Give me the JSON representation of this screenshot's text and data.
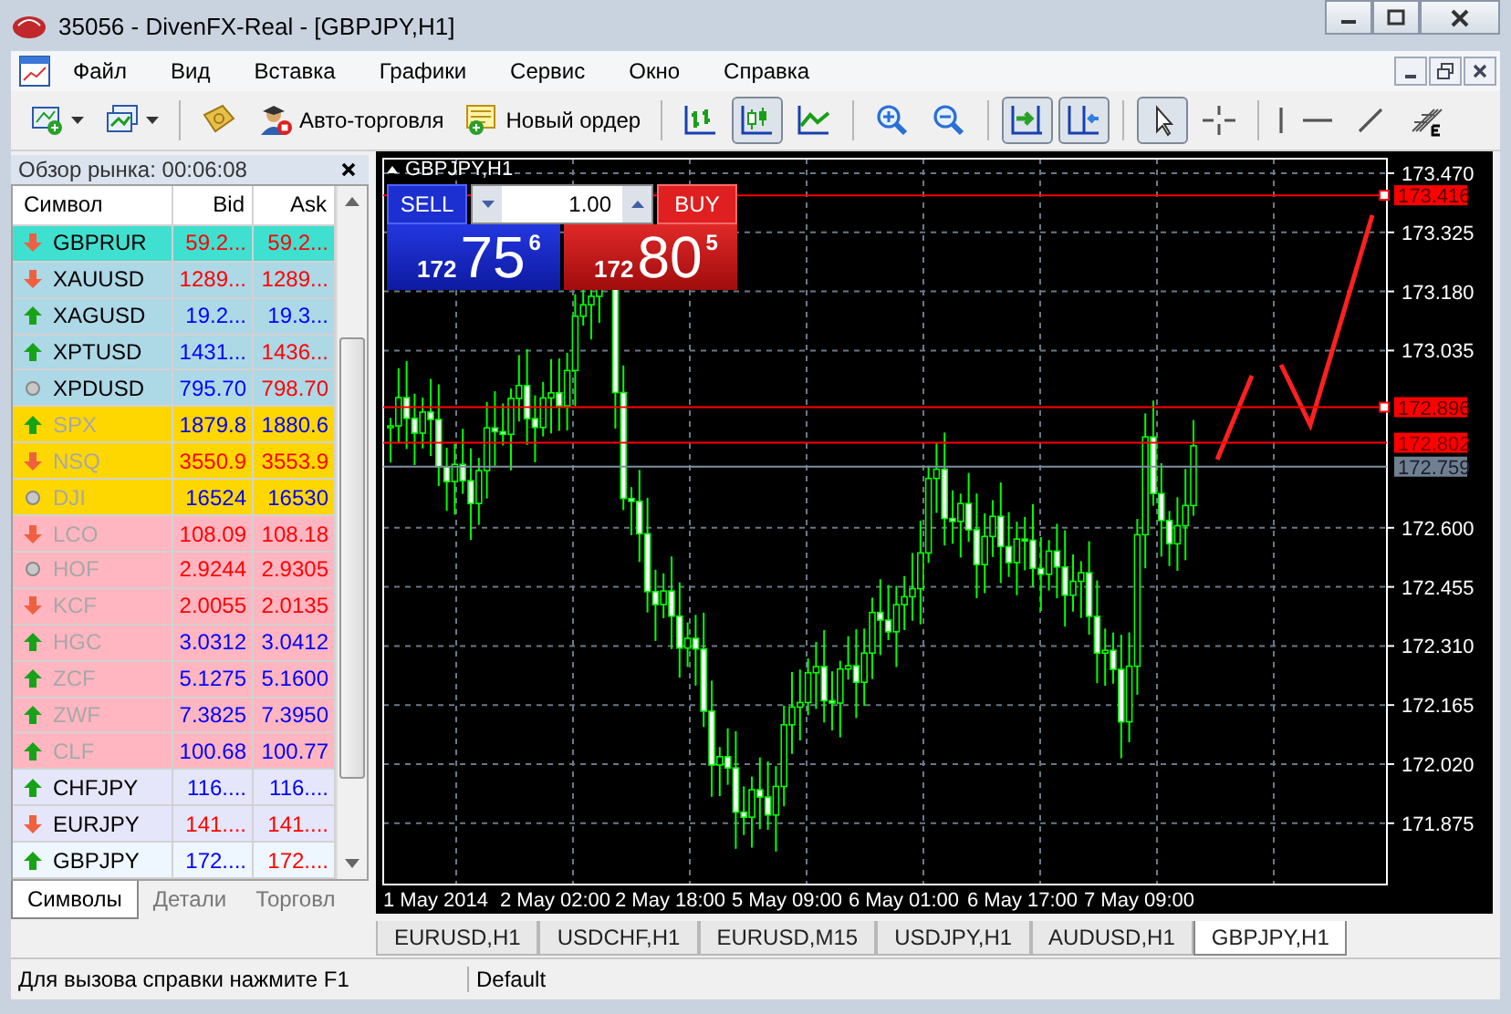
{
  "window": {
    "title": "35056 - DivenFX-Real - [GBPJPY,H1]"
  },
  "menu": [
    "Файл",
    "Вид",
    "Вставка",
    "Графики",
    "Сервис",
    "Окно",
    "Справка"
  ],
  "toolbar": {
    "buttons": [
      {
        "label": "Авто-торговля"
      },
      {
        "label": "Новый ордер"
      }
    ],
    "chart_tools": [
      {
        "pressed": false
      },
      {
        "pressed": true
      },
      {
        "pressed": false
      }
    ],
    "scroll_tools": [
      {
        "pressed": true
      },
      {
        "pressed": true
      }
    ],
    "cursor_tools": [
      {
        "pressed": true
      },
      {
        "pressed": false
      }
    ]
  },
  "market_watch": {
    "title": "Обзор рынка: 00:06:08",
    "columns": [
      "Символ",
      "Bid",
      "Ask"
    ],
    "rows": [
      {
        "symbol": "GBPRUR",
        "kind": "down",
        "color": "#40e0d0",
        "dimmed": false,
        "bid": "59.2...",
        "bid_up": false,
        "ask": "59.2...",
        "ask_up": false
      },
      {
        "symbol": "XAUUSD",
        "kind": "down",
        "color": "#add8e6",
        "dimmed": false,
        "bid": "1289...",
        "bid_up": false,
        "ask": "1289...",
        "ask_up": false
      },
      {
        "symbol": "XAGUSD",
        "kind": "up",
        "color": "#add8e6",
        "dimmed": false,
        "bid": "19.2...",
        "bid_up": true,
        "ask": "19.3...",
        "ask_up": true
      },
      {
        "symbol": "XPTUSD",
        "kind": "up",
        "color": "#add8e6",
        "dimmed": false,
        "bid": "1431...",
        "bid_up": true,
        "ask": "1436...",
        "ask_up": false
      },
      {
        "symbol": "XPDUSD",
        "kind": "flat",
        "color": "#add8e6",
        "dimmed": false,
        "bid": "795.70",
        "bid_up": true,
        "ask": "798.70",
        "ask_up": false
      },
      {
        "symbol": "SPX",
        "kind": "up",
        "color": "#ffd700",
        "dimmed": true,
        "bid": "1879.8",
        "bid_up": true,
        "ask": "1880.6",
        "ask_up": true
      },
      {
        "symbol": "NSQ",
        "kind": "down",
        "color": "#ffd700",
        "dimmed": true,
        "bid": "3550.9",
        "bid_up": false,
        "ask": "3553.9",
        "ask_up": false
      },
      {
        "symbol": "DJI",
        "kind": "flat",
        "color": "#ffd700",
        "dimmed": true,
        "bid": "16524",
        "bid_up": true,
        "ask": "16530",
        "ask_up": true
      },
      {
        "symbol": "LCO",
        "kind": "down",
        "color": "#ffb6c1",
        "dimmed": true,
        "bid": "108.09",
        "bid_up": false,
        "ask": "108.18",
        "ask_up": false
      },
      {
        "symbol": "HOF",
        "kind": "flat",
        "color": "#ffb6c1",
        "dimmed": true,
        "bid": "2.9244",
        "bid_up": false,
        "ask": "2.9305",
        "ask_up": false
      },
      {
        "symbol": "KCF",
        "kind": "down",
        "color": "#ffb6c1",
        "dimmed": true,
        "bid": "2.0055",
        "bid_up": false,
        "ask": "2.0135",
        "ask_up": false
      },
      {
        "symbol": "HGC",
        "kind": "up",
        "color": "#ffb6c1",
        "dimmed": true,
        "bid": "3.0312",
        "bid_up": true,
        "ask": "3.0412",
        "ask_up": true
      },
      {
        "symbol": "ZCF",
        "kind": "up",
        "color": "#ffb6c1",
        "dimmed": true,
        "bid": "5.1275",
        "bid_up": true,
        "ask": "5.1600",
        "ask_up": true
      },
      {
        "symbol": "ZWF",
        "kind": "up",
        "color": "#ffb6c1",
        "dimmed": true,
        "bid": "7.3825",
        "bid_up": true,
        "ask": "7.3950",
        "ask_up": true
      },
      {
        "symbol": "CLF",
        "kind": "up",
        "color": "#ffb6c1",
        "dimmed": true,
        "bid": "100.68",
        "bid_up": true,
        "ask": "100.77",
        "ask_up": true
      },
      {
        "symbol": "CHFJPY",
        "kind": "up",
        "color": "#e6e6fa",
        "dimmed": false,
        "bid": "116....",
        "bid_up": true,
        "ask": "116....",
        "ask_up": true
      },
      {
        "symbol": "EURJPY",
        "kind": "down",
        "color": "#e6e6fa",
        "dimmed": false,
        "bid": "141....",
        "bid_up": false,
        "ask": "141....",
        "ask_up": false
      },
      {
        "symbol": "GBPJPY",
        "kind": "up",
        "color": "#eef6ff",
        "dimmed": false,
        "bid": "172....",
        "bid_up": true,
        "ask": "172....",
        "ask_up": false
      }
    ],
    "tabs": [
      {
        "label": "Символы",
        "selected": true
      },
      {
        "label": "Детали",
        "selected": false
      },
      {
        "label": "Торговл",
        "selected": false
      }
    ]
  },
  "chart": {
    "title": "GBPJPY,H1",
    "trade_panel": {
      "sell_label": "SELL",
      "buy_label": "BUY",
      "volume": "1.00",
      "sell_price": {
        "big": "172",
        "main": "75",
        "pip": "6"
      },
      "buy_price": {
        "big": "172",
        "main": "80",
        "pip": "5"
      }
    },
    "price_axis": [
      "173.470",
      "173.325",
      "173.180",
      "173.035",
      "172.600",
      "172.455",
      "172.310",
      "172.165",
      "172.020",
      "171.875"
    ],
    "time_axis": [
      "1 May 2014",
      "2 May 02:00",
      "2 May 18:00",
      "5 May 09:00",
      "6 May 01:00",
      "6 May 17:00",
      "7 May 09:00"
    ],
    "price_lines": [
      {
        "label": "173.416",
        "kind": "level"
      },
      {
        "label": "172.896",
        "kind": "level"
      },
      {
        "label": "172.802",
        "kind": "ask"
      },
      {
        "label": "172.759",
        "kind": "bid"
      }
    ]
  },
  "chart_tabs": [
    {
      "label": "EURUSD,H1",
      "selected": false
    },
    {
      "label": "USDCHF,H1",
      "selected": false
    },
    {
      "label": "EURUSD,M15",
      "selected": false
    },
    {
      "label": "USDJPY,H1",
      "selected": false
    },
    {
      "label": "AUDUSD,H1",
      "selected": false
    },
    {
      "label": "GBPJPY,H1",
      "selected": true
    }
  ],
  "status_bar": [
    "Для вызова справки нажмите F1",
    "Default"
  ]
}
